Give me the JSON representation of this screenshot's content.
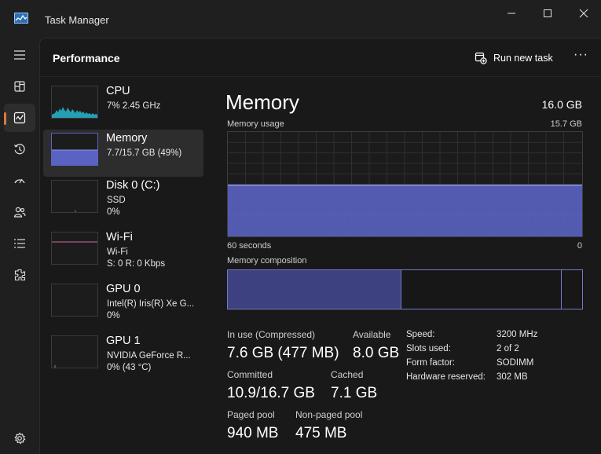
{
  "window": {
    "title": "Task Manager"
  },
  "header": {
    "title": "Performance",
    "run_task_label": "Run new task",
    "more_label": "···"
  },
  "devices": [
    {
      "name": "CPU",
      "line2": "7% 2.45 GHz",
      "line3": ""
    },
    {
      "name": "Memory",
      "line2": "7.7/15.7 GB (49%)",
      "line3": ""
    },
    {
      "name": "Disk 0 (C:)",
      "line2": "SSD",
      "line3": "0%"
    },
    {
      "name": "Wi-Fi",
      "line2": "Wi-Fi",
      "line3": "S: 0 R: 0 Kbps"
    },
    {
      "name": "GPU 0",
      "line2": "Intel(R) Iris(R) Xe G...",
      "line3": "0%"
    },
    {
      "name": "GPU 1",
      "line2": "NVIDIA GeForce R...",
      "line3": "0% (43 °C)"
    }
  ],
  "detail": {
    "title": "Memory",
    "total": "16.0 GB",
    "usage_label": "Memory usage",
    "usage_max": "15.7 GB",
    "time_label": "60 seconds",
    "time_min": "0",
    "composition_label": "Memory composition",
    "usage_fraction": 0.49,
    "composition": {
      "in_use_fraction": 0.49,
      "modified_fraction": 0.0,
      "standby_fraction": 0.45
    },
    "stats": {
      "in_use_label": "In use (Compressed)",
      "in_use_value": "7.6 GB (477 MB)",
      "available_label": "Available",
      "available_value": "8.0 GB",
      "committed_label": "Committed",
      "committed_value": "10.9/16.7 GB",
      "cached_label": "Cached",
      "cached_value": "7.1 GB",
      "paged_label": "Paged pool",
      "paged_value": "940 MB",
      "nonpaged_label": "Non-paged pool",
      "nonpaged_value": "475 MB"
    },
    "specs": [
      {
        "key": "Speed:",
        "value": "3200 MHz"
      },
      {
        "key": "Slots used:",
        "value": "2 of 2"
      },
      {
        "key": "Form factor:",
        "value": "SODIMM"
      },
      {
        "key": "Hardware reserved:",
        "value": "302 MB"
      }
    ]
  },
  "nav_icons": [
    "hamburger-icon",
    "processes-icon",
    "performance-icon",
    "app-history-icon",
    "startup-apps-icon",
    "users-icon",
    "details-icon",
    "services-icon",
    "settings-icon"
  ],
  "colors": {
    "accent": "#d97a3a",
    "memory": "#5a63c2",
    "cpu": "#27b6cf",
    "wifi": "#c96a9e",
    "gpu": "#5b8fd6"
  }
}
